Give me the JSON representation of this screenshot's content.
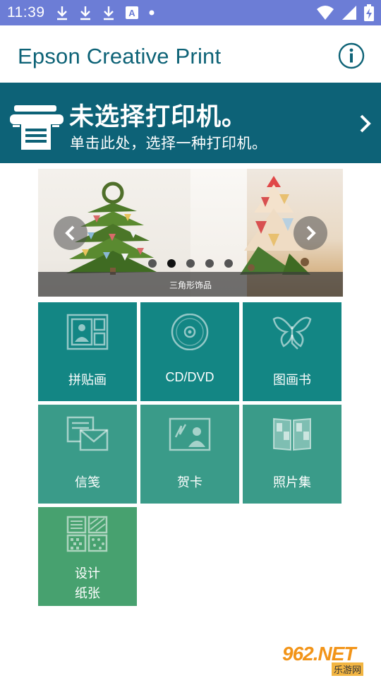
{
  "status_bar": {
    "time": "11:39",
    "icons": [
      "download-icon",
      "download-icon",
      "download-icon",
      "text-a-icon",
      "dot-icon"
    ],
    "right_icons": [
      "wifi-icon",
      "signal-icon",
      "battery-charging-icon"
    ]
  },
  "app_bar": {
    "title": "Epson Creative Print",
    "info_icon": "info-icon"
  },
  "printer_banner": {
    "title": "未选择打印机。",
    "subtitle": "单击此处，选择一种打印机。",
    "icon": "printer-icon"
  },
  "carousel": {
    "caption": "三角形饰品",
    "dot_count": 5,
    "active_dot": 1
  },
  "tiles": [
    {
      "label": "拼贴画",
      "icon": "collage-icon"
    },
    {
      "label": "CD/DVD",
      "icon": "disc-icon"
    },
    {
      "label": "图画书",
      "icon": "butterfly-icon"
    },
    {
      "label": "信笺",
      "icon": "letter-icon"
    },
    {
      "label": "贺卡",
      "icon": "greeting-card-icon"
    },
    {
      "label": "照片集",
      "icon": "photo-book-icon"
    },
    {
      "label_line1": "设计",
      "label_line2": "纸张",
      "icon": "design-paper-icon"
    }
  ],
  "watermark": {
    "logo": "962.NET",
    "sub": "乐游网"
  },
  "colors": {
    "status_bar": "#6c7dd6",
    "banner": "#0d6277",
    "tile_dark": "#138684",
    "tile_mid": "#3a9b89",
    "tile_green": "#47a16f"
  }
}
